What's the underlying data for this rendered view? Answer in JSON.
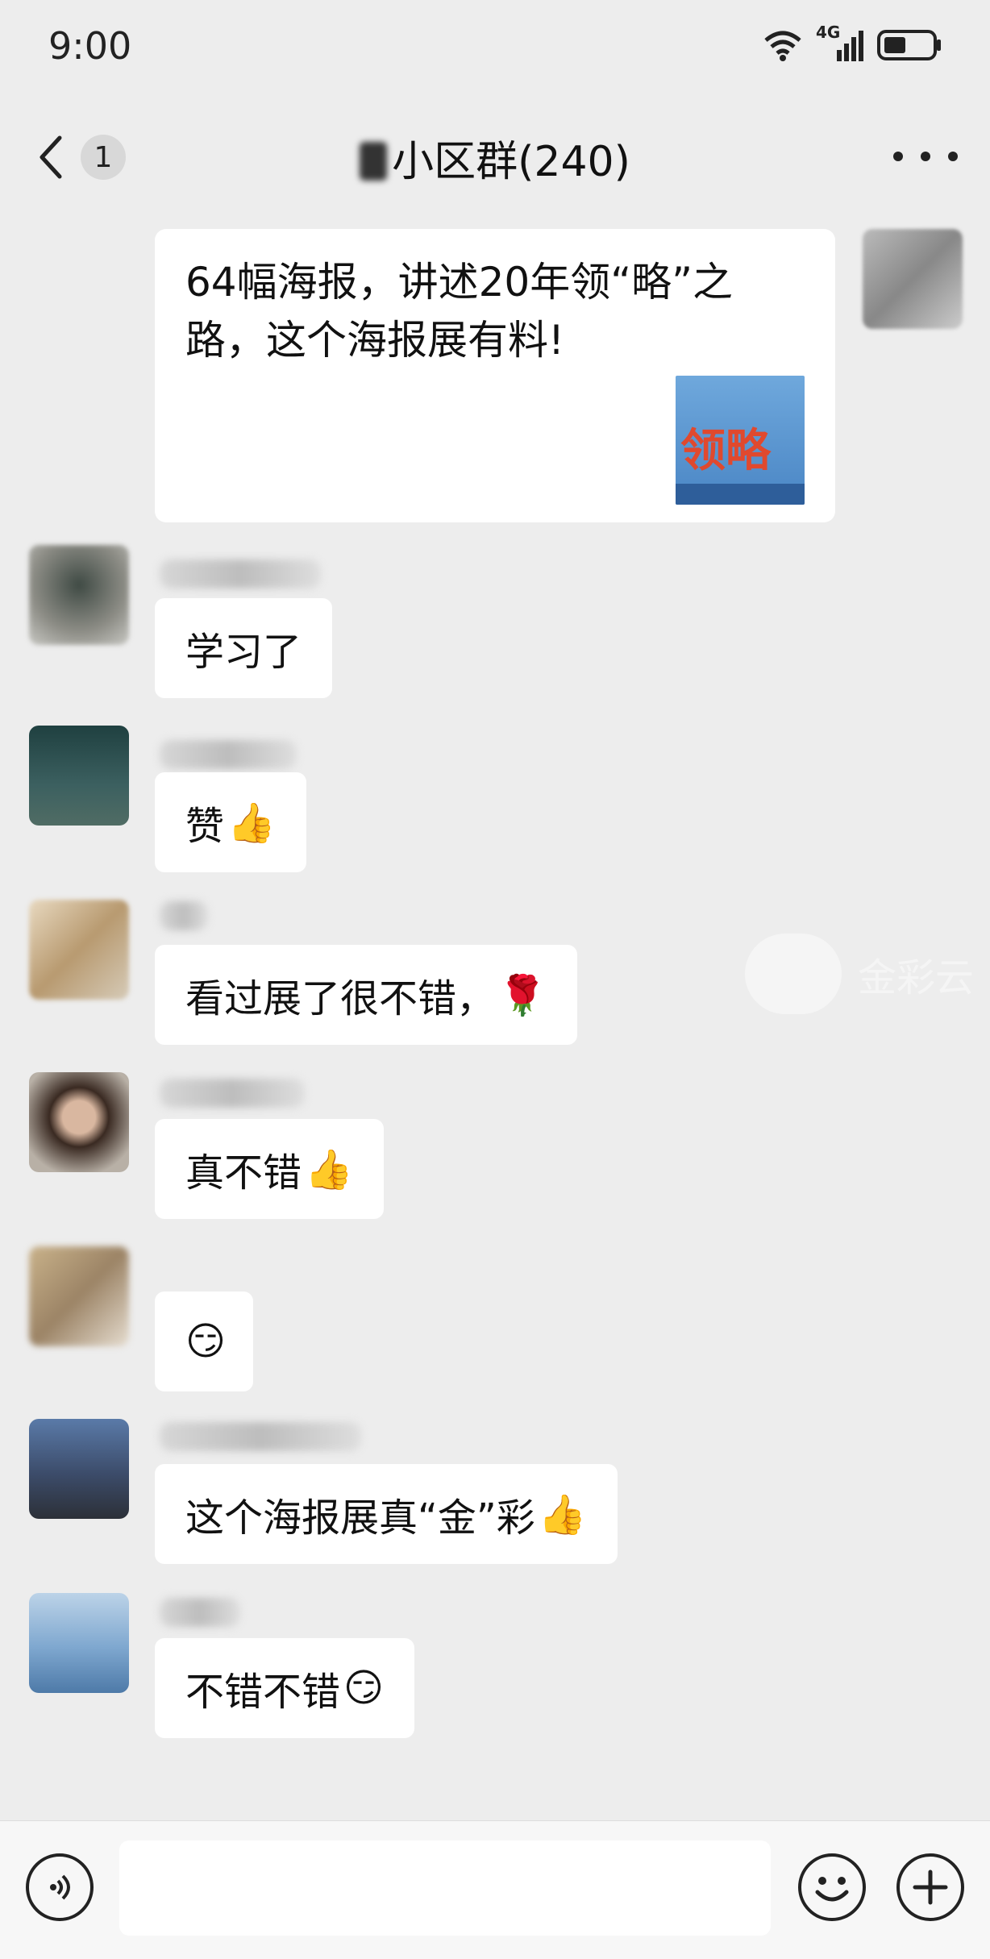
{
  "status_bar": {
    "time": "9:00",
    "network": "4G",
    "icons": [
      "wifi-icon",
      "signal-icon",
      "battery-icon"
    ]
  },
  "nav": {
    "back_badge": "1",
    "title": "小区群(240)",
    "icons": [
      "chevron-left-icon",
      "more-icon"
    ]
  },
  "outgoing_card": {
    "title": "64幅海报，讲述20年领“略”之路，这个海报展有料!",
    "thumb_text": "领略"
  },
  "messages": [
    {
      "text": "学习了",
      "emoji": ""
    },
    {
      "text": "赞",
      "emoji": "👍"
    },
    {
      "text": "看过展了很不错，",
      "emoji": "🌹"
    },
    {
      "text": "真不错",
      "emoji": "👍"
    },
    {
      "text": "",
      "emoji": "😏"
    },
    {
      "text": "这个海报展真“金”彩",
      "emoji": "👍"
    },
    {
      "text": "不错不错",
      "emoji": "😏"
    }
  ],
  "watermark": {
    "text": "金彩云"
  },
  "input_bar": {
    "placeholder": "",
    "icons": [
      "voice-icon",
      "emoji-icon",
      "plus-icon"
    ]
  },
  "colors": {
    "background": "#ededed",
    "bubble": "#ffffff",
    "text": "#111111"
  }
}
